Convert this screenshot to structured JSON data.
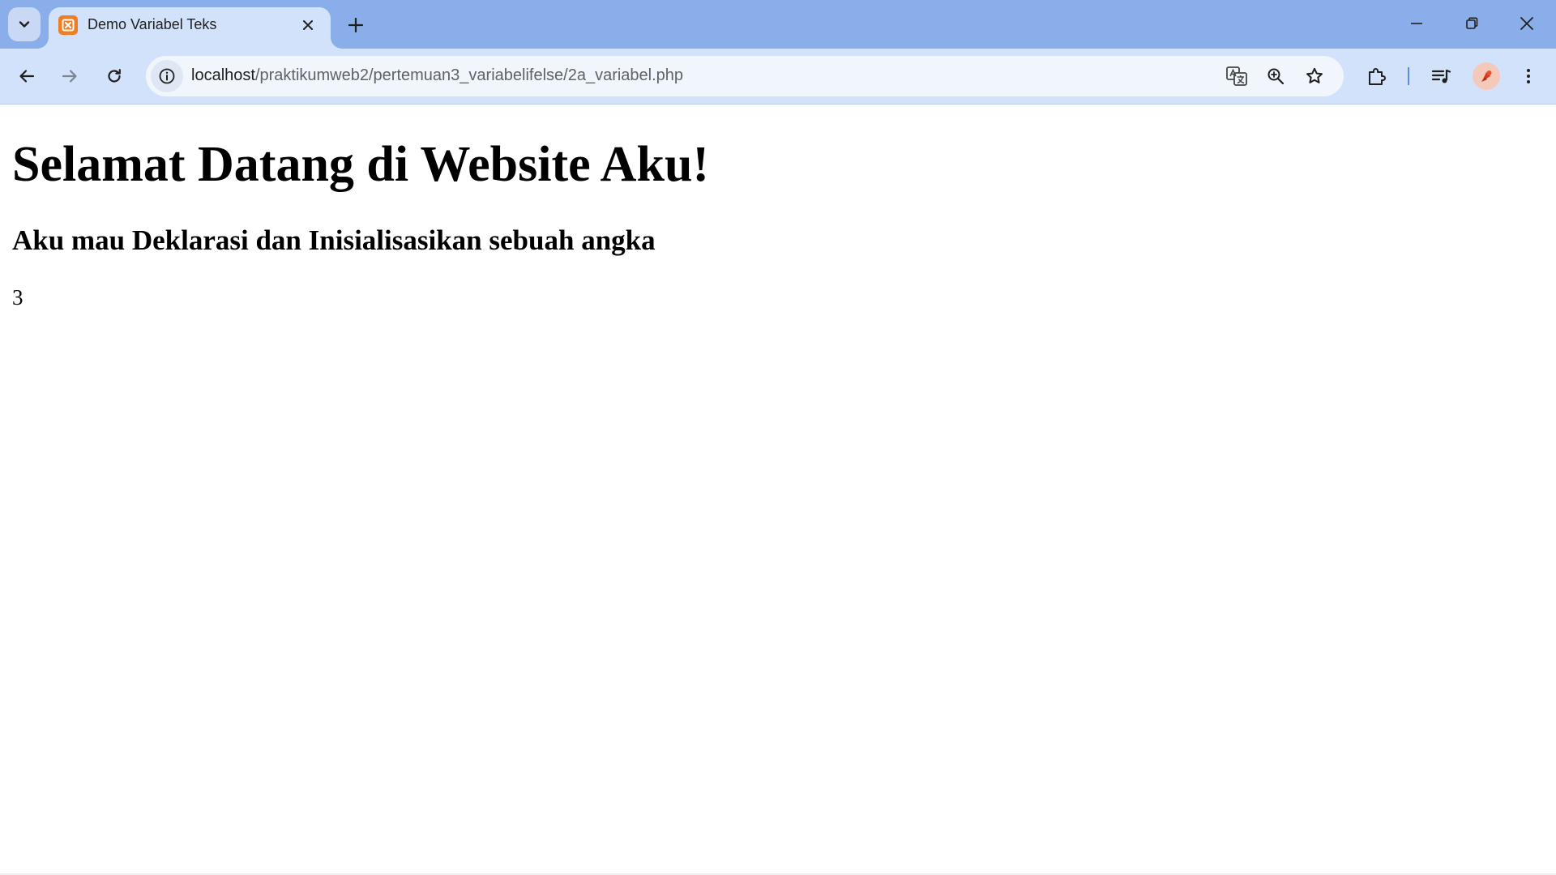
{
  "browser": {
    "tab": {
      "title": "Demo Variabel Teks",
      "favicon": "xampp-icon"
    },
    "address_bar": {
      "url_host": "localhost",
      "url_path": "/praktikumweb2/pertemuan3_variabelifelse/2a_variabel.php"
    },
    "colors": {
      "frame": "#8aaee9",
      "toolbar": "#d3e2fb",
      "omnibox": "#f1f5fc",
      "favicon": "#f07d22"
    }
  },
  "page": {
    "heading": "Selamat Datang di Website Aku!",
    "subheading": "Aku mau Deklarasi dan Inisialisasikan sebuah angka",
    "value": "3"
  }
}
